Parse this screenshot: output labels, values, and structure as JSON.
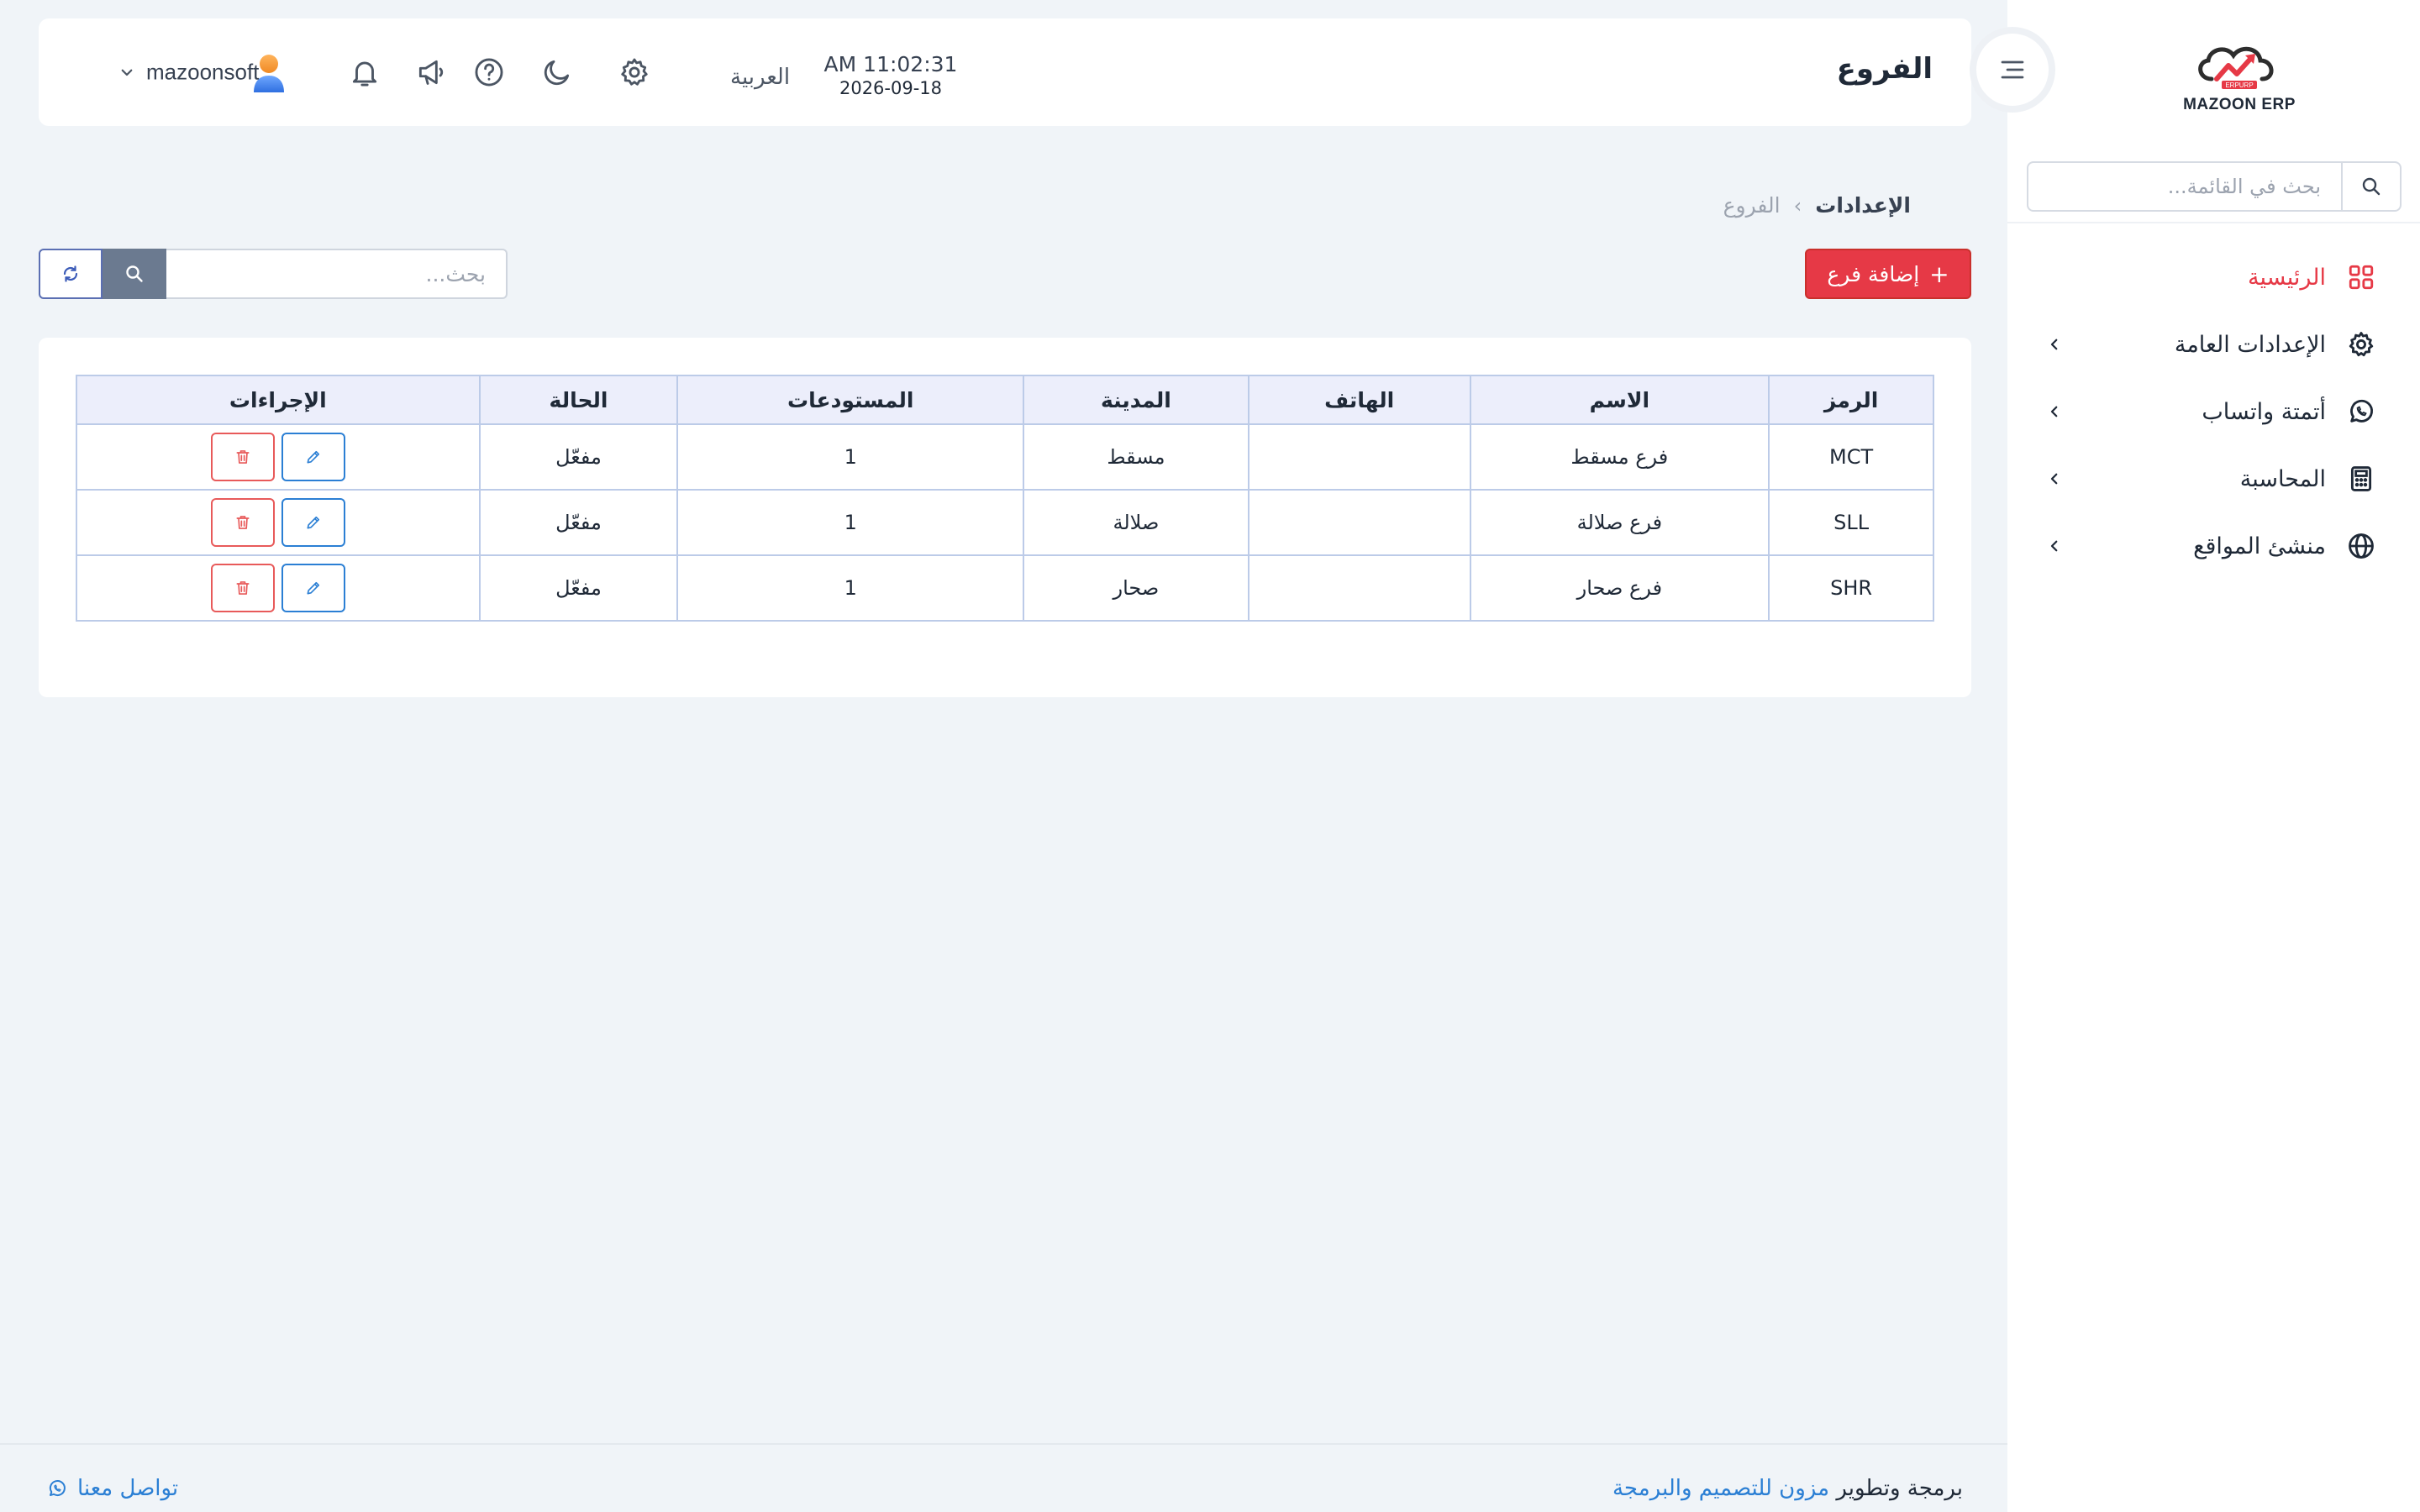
{
  "app": {
    "logo_text": "MAZOON ERP",
    "logo_small": "ERPURP"
  },
  "sidebar": {
    "search_placeholder": "بحث في القائمة...",
    "items": [
      {
        "label": "الرئيسية",
        "icon": "grid-icon",
        "active": true
      },
      {
        "label": "الإعدادات العامة",
        "icon": "gear-icon"
      },
      {
        "label": "أتمتة واتساب",
        "icon": "whatsapp-icon"
      },
      {
        "label": "المحاسبة",
        "icon": "calculator-icon"
      },
      {
        "label": "منشئ المواقع",
        "icon": "globe-icon"
      }
    ]
  },
  "header": {
    "title": "الفروع",
    "time": "AM 11:02:31",
    "date": "2026-09-18",
    "language": "العربية",
    "username": "mazoonsoft"
  },
  "breadcrumb": {
    "root": "الإعدادات",
    "separator": "›",
    "current": "الفروع"
  },
  "toolbar": {
    "add_label": "إضافة فرع",
    "add_icon": "+",
    "search_placeholder": "بحث..."
  },
  "table": {
    "headers": [
      "الرمز",
      "الاسم",
      "الهاتف",
      "المدينة",
      "المستودعات",
      "الحالة",
      "الإجراءات"
    ],
    "rows": [
      {
        "code": "MCT",
        "name": "فرع مسقط",
        "phone": "",
        "city": "مسقط",
        "warehouses": "1",
        "status": "مفعّل"
      },
      {
        "code": "SLL",
        "name": "فرع صلالة",
        "phone": "",
        "city": "صلالة",
        "warehouses": "1",
        "status": "مفعّل"
      },
      {
        "code": "SHR",
        "name": "فرع صحار",
        "phone": "",
        "city": "صحار",
        "warehouses": "1",
        "status": "مفعّل"
      }
    ]
  },
  "footer": {
    "prefix": "برمجة وتطوير",
    "company": "مزون للتصميم والبرمجة",
    "contact": "تواصل معنا"
  },
  "colors": {
    "accent": "#e63946",
    "link": "#2b7fd4",
    "table_header_bg": "#eceefb",
    "table_border": "#bccbe8"
  }
}
